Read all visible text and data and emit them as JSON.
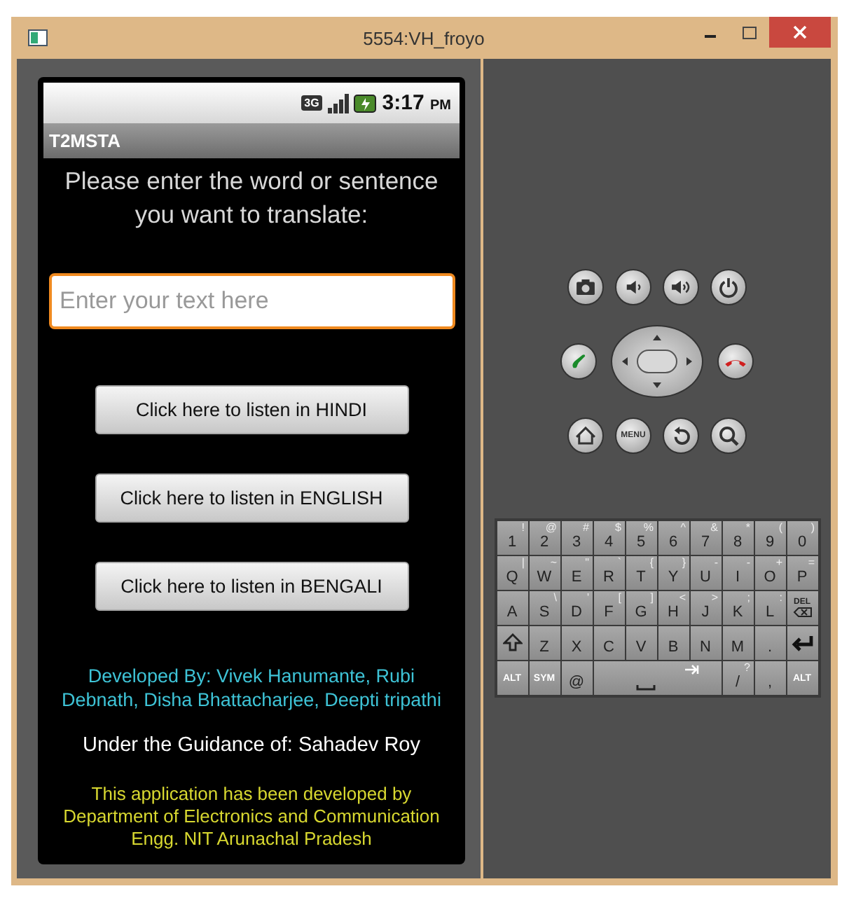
{
  "window": {
    "title": "5554:VH_froyo"
  },
  "status_bar": {
    "network": "3G",
    "time": "3:17",
    "meridiem": "PM"
  },
  "app_bar": {
    "title": "T2MSTA"
  },
  "prompt": "Please enter the word or sentence you want to translate:",
  "text_field": {
    "placeholder": "Enter your text here"
  },
  "buttons": [
    "Click here to listen in HINDI",
    "Click here to listen in ENGLISH",
    "Click here to listen in BENGALI"
  ],
  "credits": [
    {
      "kind": "developers",
      "text": "Developed By: Vivek Hanumante, Rubi Debnath,  Disha Bhattacharjee, Deepti tripathi"
    },
    {
      "kind": "guide",
      "text": "Under the Guidance of: Sahadev Roy"
    },
    {
      "kind": "department",
      "text": "This application has been developed by Department of Electronics and Communication Engg. NIT Arunachal Pradesh"
    }
  ],
  "hardware_buttons": [
    [
      {
        "kind": "camera"
      },
      {
        "kind": "volume-down"
      },
      {
        "kind": "volume-up"
      },
      {
        "kind": "power"
      }
    ],
    [
      {
        "kind": "call"
      },
      {
        "kind": "dpad"
      },
      {
        "kind": "end-call"
      }
    ],
    [
      {
        "kind": "home"
      },
      {
        "kind": "menu",
        "label": "MENU"
      },
      {
        "kind": "back"
      },
      {
        "kind": "search"
      }
    ]
  ],
  "keyboard": [
    [
      {
        "kind": "char",
        "main": "1",
        "alt": "!"
      },
      {
        "kind": "char",
        "main": "2",
        "alt": "@"
      },
      {
        "kind": "char",
        "main": "3",
        "alt": "#"
      },
      {
        "kind": "char",
        "main": "4",
        "alt": "$"
      },
      {
        "kind": "char",
        "main": "5",
        "alt": "%"
      },
      {
        "kind": "char",
        "main": "6",
        "alt": "^"
      },
      {
        "kind": "char",
        "main": "7",
        "alt": "&"
      },
      {
        "kind": "char",
        "main": "8",
        "alt": "*"
      },
      {
        "kind": "char",
        "main": "9",
        "alt": "("
      },
      {
        "kind": "char",
        "main": "0",
        "alt": ")"
      }
    ],
    [
      {
        "kind": "char",
        "main": "Q",
        "alt": "|"
      },
      {
        "kind": "char",
        "main": "W",
        "alt": "~"
      },
      {
        "kind": "char",
        "main": "E",
        "alt": "\""
      },
      {
        "kind": "char",
        "main": "R",
        "alt": "`"
      },
      {
        "kind": "char",
        "main": "T",
        "alt": "{"
      },
      {
        "kind": "char",
        "main": "Y",
        "alt": "}"
      },
      {
        "kind": "char",
        "main": "U",
        "alt": "-"
      },
      {
        "kind": "char",
        "main": "I",
        "alt": "-"
      },
      {
        "kind": "char",
        "main": "O",
        "alt": "+"
      },
      {
        "kind": "char",
        "main": "P",
        "alt": "="
      }
    ],
    [
      {
        "kind": "char",
        "main": "A"
      },
      {
        "kind": "char",
        "main": "S",
        "alt": "\\"
      },
      {
        "kind": "char",
        "main": "D",
        "alt": "'"
      },
      {
        "kind": "char",
        "main": "F",
        "alt": "["
      },
      {
        "kind": "char",
        "main": "G",
        "alt": "]"
      },
      {
        "kind": "char",
        "main": "H",
        "alt": "<"
      },
      {
        "kind": "char",
        "main": "J",
        "alt": ">"
      },
      {
        "kind": "char",
        "main": "K",
        "alt": ";"
      },
      {
        "kind": "char",
        "main": "L",
        "alt": ":"
      },
      {
        "kind": "del",
        "main": "DEL"
      }
    ],
    [
      {
        "kind": "shift"
      },
      {
        "kind": "char",
        "main": "Z"
      },
      {
        "kind": "char",
        "main": "X"
      },
      {
        "kind": "char",
        "main": "C"
      },
      {
        "kind": "char",
        "main": "V"
      },
      {
        "kind": "char",
        "main": "B"
      },
      {
        "kind": "char",
        "main": "N"
      },
      {
        "kind": "char",
        "main": "M"
      },
      {
        "kind": "char",
        "main": "."
      },
      {
        "kind": "enter"
      }
    ],
    [
      {
        "kind": "label",
        "main": "ALT"
      },
      {
        "kind": "label",
        "main": "SYM"
      },
      {
        "kind": "char",
        "main": "@"
      },
      {
        "kind": "space"
      },
      {
        "kind": "char",
        "main": "/",
        "alt": "?"
      },
      {
        "kind": "char",
        "main": ","
      },
      {
        "kind": "label",
        "main": "ALT"
      }
    ]
  ]
}
